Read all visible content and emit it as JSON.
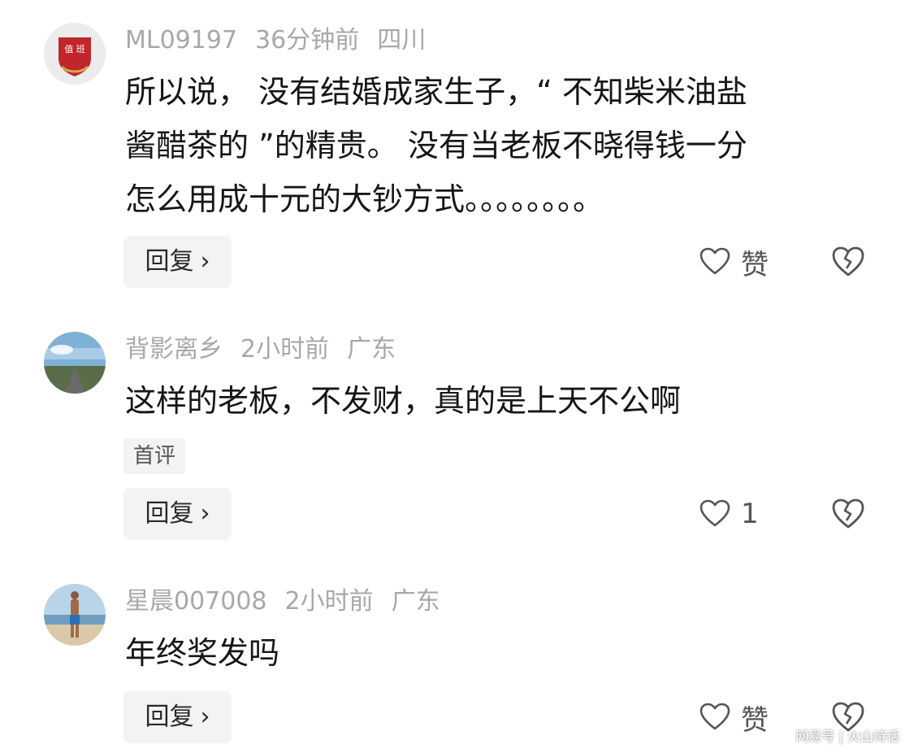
{
  "comments": [
    {
      "username": "ML09197",
      "time": "36分钟前",
      "location": "四川",
      "text_lines": [
        "所以说， 没有结婚成家生子，“ 不知柴米油盐",
        "酱醋茶的 ”的精贵。 没有当老板不晓得钱一分",
        "怎么用成十元的大钞方式。。。。。。。。"
      ],
      "badge": "",
      "reply_label": "回复",
      "like_label": "赞",
      "avatar_text": "值 班"
    },
    {
      "username": "背影离乡",
      "time": "2小时前",
      "location": "广东",
      "text_lines": [
        "这样的老板，不发财，真的是上天不公啊"
      ],
      "badge": "首评",
      "reply_label": "回复",
      "like_label": "1"
    },
    {
      "username": "星晨007008",
      "time": "2小时前",
      "location": "广东",
      "text_lines": [
        "年终奖发吗"
      ],
      "badge": "",
      "reply_label": "回复",
      "like_label": "赞"
    }
  ],
  "icons": {
    "like": "heart-outline-icon",
    "dislike": "broken-heart-icon",
    "reply_arrow": "chevron-right-icon"
  },
  "watermark": "网易号 | 火山诗话",
  "colors": {
    "text": "#161616",
    "meta": "#a8a8a8",
    "button_bg": "#f3f3f3",
    "avatar1_red": "#c0262b",
    "avatar1_gold": "#d4a94a"
  }
}
